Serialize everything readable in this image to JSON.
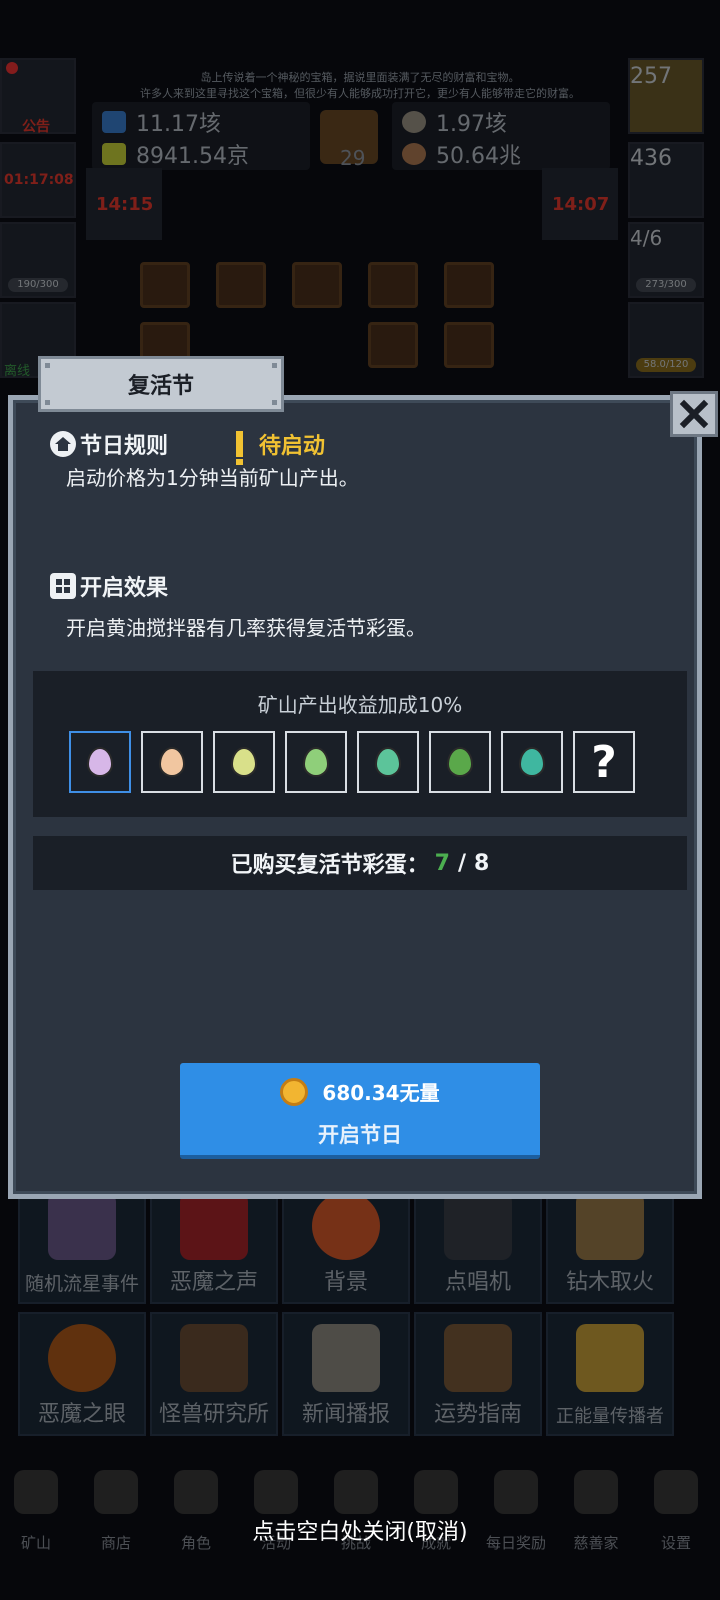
{
  "background": {
    "story_lines": [
      "岛上传说着一个神秘的宝箱，据说里面装满了无尽的财富和宝物。",
      "许多人来到这里寻找这个宝箱，但很少有人能够成功打开它，更少有人能够带走它的财富。"
    ],
    "resources": [
      {
        "value": "11.17垓"
      },
      {
        "value": "1.97垓"
      },
      {
        "value": "8941.54京"
      },
      {
        "value": "50.64兆"
      }
    ],
    "book_count": "29",
    "left_side": [
      {
        "label": "公告"
      },
      {
        "label": "01:17:08"
      },
      {
        "bar": "190/300"
      },
      {
        "label": "离线"
      }
    ],
    "right_side": [
      {
        "label": "257"
      },
      {
        "label": "436"
      },
      {
        "label": "4/6",
        "bar": "273/300"
      },
      {
        "bar": "58.0/120"
      }
    ],
    "timers": [
      "14:15",
      "14:07"
    ],
    "features": [
      {
        "label": "随机流星事件"
      },
      {
        "label": "恶魔之声"
      },
      {
        "label": "背景"
      },
      {
        "label": "点唱机"
      },
      {
        "label": "钻木取火"
      },
      {
        "label": "恶魔之眼"
      },
      {
        "label": "怪兽研究所"
      },
      {
        "label": "新闻播报"
      },
      {
        "label": "运势指南"
      },
      {
        "label": "正能量传播者"
      }
    ],
    "nav": [
      {
        "label": "矿山"
      },
      {
        "label": "商店"
      },
      {
        "label": "角色"
      },
      {
        "label": "活动"
      },
      {
        "label": "挑战"
      },
      {
        "label": "成就"
      },
      {
        "label": "每日奖励"
      },
      {
        "label": "慈善家"
      },
      {
        "label": "设置"
      }
    ]
  },
  "modal": {
    "tab_title": "复活节",
    "rules_title": "节日规则",
    "status": "待启动",
    "rules_desc": "启动价格为1分钟当前矿山产出。",
    "effect_title": "开启效果",
    "effect_desc": "开启黄油搅拌器有几率获得复活节彩蛋。",
    "bonus_text": "矿山产出收益加成10%",
    "eggs": [
      {
        "color": "#d7b7e8",
        "selected": true
      },
      {
        "color": "#f1c6a0"
      },
      {
        "color": "#d9e08a"
      },
      {
        "color": "#8fcf7a"
      },
      {
        "color": "#5cc49a"
      },
      {
        "color": "#5aa84a"
      },
      {
        "color": "#3fb7a0"
      },
      {
        "unknown": true,
        "symbol": "?"
      }
    ],
    "bought_label": "已购买复活节彩蛋：",
    "bought_current": "7",
    "bought_total": "8",
    "price": "680.34无量",
    "start_label": "开启节日"
  },
  "hint": "点击空白处关闭(取消)"
}
